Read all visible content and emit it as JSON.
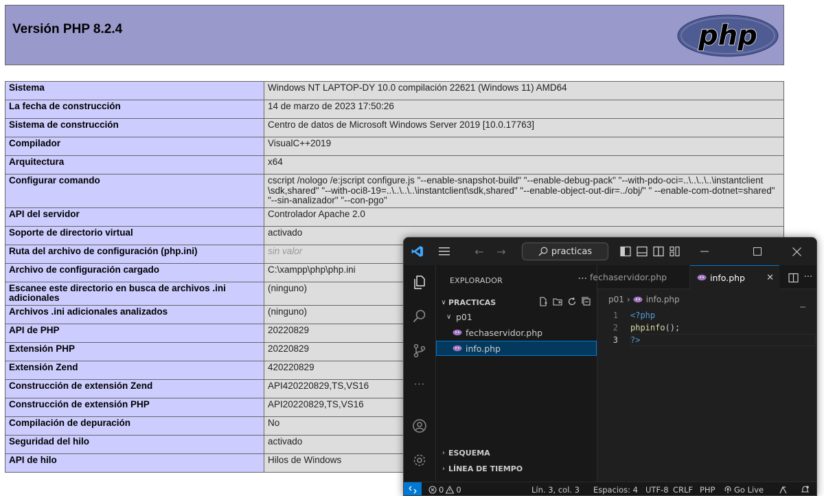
{
  "php": {
    "title": "Versión PHP 8.2.4",
    "logo_text": "php",
    "rows": [
      {
        "label": "Sistema",
        "value": "Windows NT LAPTOP-DY 10.0 compilación 22621 (Windows 11) AMD64"
      },
      {
        "label": "La fecha de construcción",
        "value": "14 de marzo de 2023 17:50:26"
      },
      {
        "label": "Sistema de construcción",
        "value": "Centro de datos de Microsoft Windows Server 2019 [10.0.17763]"
      },
      {
        "label": "Compilador",
        "value": "VisualC++2019"
      },
      {
        "label": "Arquitectura",
        "value": "x64"
      },
      {
        "label": "Configurar comando",
        "value": "cscript /nologo /e:jscript configure.js \"--enable-snapshot-build\" \"--enable-debug-pack\" \"--with-pdo-oci=..\\..\\..\\..\\instantclient \\sdk,shared\" \"--with-oci8-19=..\\..\\..\\..\\instantclient\\sdk,shared\" \"--enable-object-out-dir=../obj/\" \" --enable-com-dotnet=shared\" \"--sin-analizador\" \"--con-pgo\""
      },
      {
        "label": "API del servidor",
        "value": "Controlador Apache 2.0"
      },
      {
        "label": "Soporte de directorio virtual",
        "value": "activado"
      },
      {
        "label": "Ruta del archivo de configuración (php.ini)",
        "value": "sin valor"
      },
      {
        "label": "Archivo de configuración cargado",
        "value": "C:\\xampp\\php\\php.ini"
      },
      {
        "label": "Escanee este directorio en busca de archivos .ini adicionales",
        "value": "(ninguno)"
      },
      {
        "label": "Archivos .ini adicionales analizados",
        "value": "(ninguno)"
      },
      {
        "label": "API de PHP",
        "value": "20220829"
      },
      {
        "label": "Extensión PHP",
        "value": "20220829"
      },
      {
        "label": "Extensión Zend",
        "value": "420220829"
      },
      {
        "label": "Construcción de extensión Zend",
        "value": "API420220829,TS,VS16"
      },
      {
        "label": "Construcción de extensión PHP",
        "value": "API20220829,TS,VS16"
      },
      {
        "label": "Compilación de depuración",
        "value": "No"
      },
      {
        "label": "Seguridad del hilo",
        "value": "activado"
      },
      {
        "label": "API de hilo",
        "value": "Hilos de Windows"
      }
    ]
  },
  "vscode": {
    "search_text": "practicas",
    "explorer_title": "EXPLORADOR",
    "more_actions": "···",
    "folder_root": "PRACTICAS",
    "subfolder": "p01",
    "files": [
      "fechaservidor.php",
      "info.php"
    ],
    "section_outline": "ESQUEMA",
    "section_timeline": "LÍNEA DE TIEMPO",
    "tabs": {
      "inactive": "fechaservidor.php",
      "active": "info.php"
    },
    "breadcrumb": {
      "folder": "p01",
      "separator": "›",
      "file": "info.php"
    },
    "code": [
      {
        "line": "1",
        "text": "<?php"
      },
      {
        "line": "2",
        "text_fn": "phpinfo",
        "text_rest": "();"
      },
      {
        "line": "3",
        "text": "?>"
      }
    ],
    "status": {
      "errors": "0",
      "warnings": "0",
      "position": "Lín. 3, col. 3",
      "spaces": "Espacios: 4",
      "encoding": "UTF-8",
      "eol": "CRLF",
      "language": "PHP",
      "golive": "Go Live"
    },
    "colors": {
      "accent": "#0078d4",
      "php_header": "#9999cc",
      "php_label_cell": "#ccccff",
      "php_value_cell": "#dddddd"
    }
  }
}
